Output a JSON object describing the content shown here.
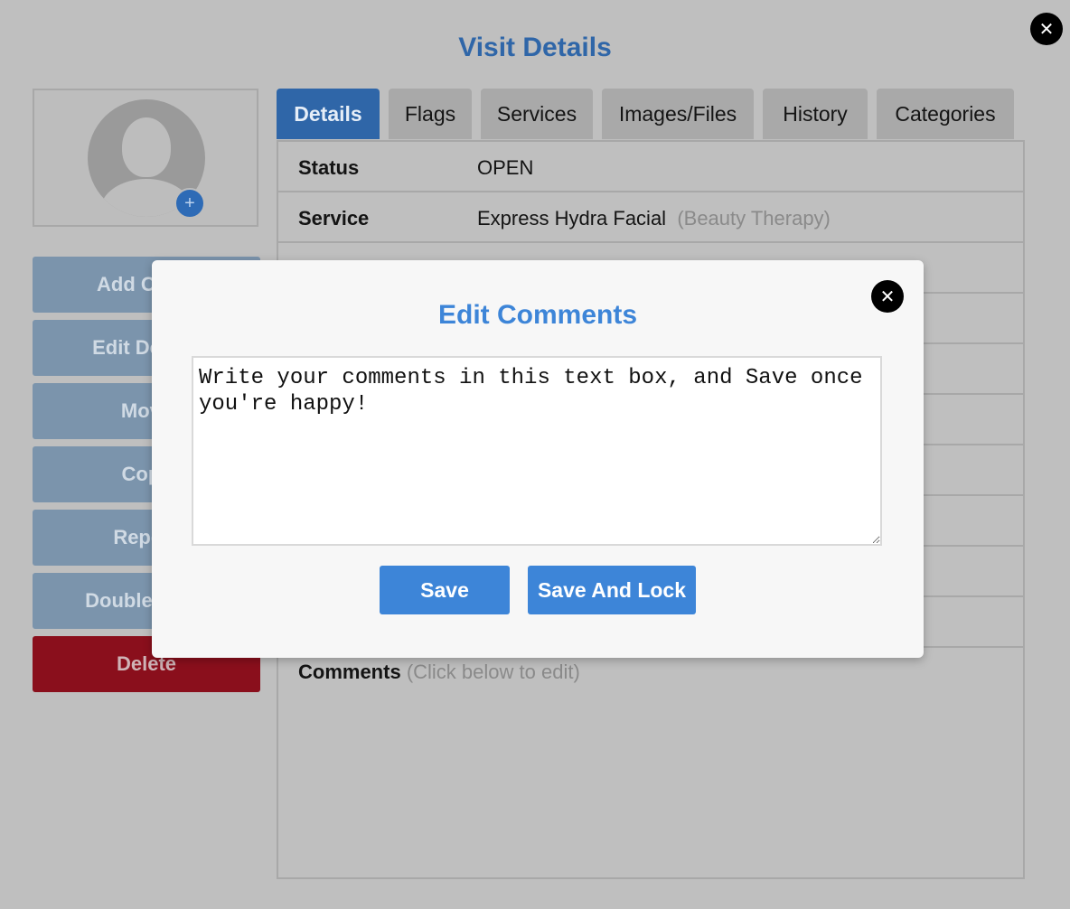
{
  "page": {
    "title": "Visit Details",
    "close_icon": "close-icon"
  },
  "avatar": {
    "add_label": "+",
    "icon": "user-silhouette-icon"
  },
  "sidebar": {
    "buttons": [
      {
        "label": "Add Client"
      },
      {
        "label": "Edit Details"
      },
      {
        "label": "Move"
      },
      {
        "label": "Copy"
      },
      {
        "label": "Repeat"
      },
      {
        "label": "Double Book"
      },
      {
        "label": "Delete"
      }
    ]
  },
  "tabs": [
    {
      "label": "Details",
      "active": true
    },
    {
      "label": "Flags"
    },
    {
      "label": "Services"
    },
    {
      "label": "Images/Files"
    },
    {
      "label": "History"
    },
    {
      "label": "Categories"
    }
  ],
  "details": {
    "rows": [
      {
        "label": "Status",
        "value": "OPEN",
        "extra": ""
      },
      {
        "label": "Service",
        "value": "Express Hydra Facial",
        "extra": "(Beauty Therapy)"
      }
    ],
    "comments_label": "Comments",
    "comments_hint": "(Click below to edit)"
  },
  "modal": {
    "title": "Edit Comments",
    "comment_text": "Write your comments in this text box, and Save once you're happy!",
    "save_label": "Save",
    "save_lock_label": "Save And Lock"
  },
  "colors": {
    "accent": "#3d85d8",
    "title_blue": "#2f66a8",
    "delete_red": "#8a0f1c",
    "backdrop": "#bfbfbf"
  }
}
